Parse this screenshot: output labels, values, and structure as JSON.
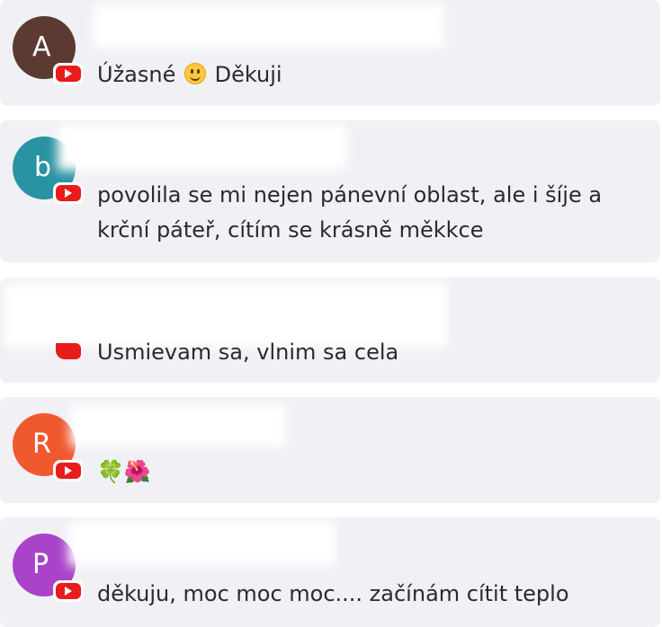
{
  "comments": [
    {
      "avatar_letter": "A",
      "avatar_color": "#5b3a32",
      "message_before": "Úžasné ",
      "emoji": "slightly-smiling-face",
      "message_after": " Děkuji"
    },
    {
      "avatar_letter": "b",
      "avatar_color": "#2a93a3",
      "message": "povolila se mi nejen pánevní oblast, ale i šíje a krční páteř, cítím se krásně měkkce"
    },
    {
      "avatar_letter": "",
      "avatar_color": "#f0f0f5",
      "message": "Usmievam sa, vlnim sa cela"
    },
    {
      "avatar_letter": "R",
      "avatar_color": "#f0582e",
      "message": "🍀🌺"
    },
    {
      "avatar_letter": "P",
      "avatar_color": "#a944c9",
      "message": "děkuju, moc moc moc.... začínám cítit teplo"
    }
  ],
  "colors": {
    "card_background": "#f0f0f5",
    "text": "#2b2b2b",
    "youtube_red": "#e81c1c"
  },
  "icons": {
    "source_badge": "youtube-icon"
  }
}
